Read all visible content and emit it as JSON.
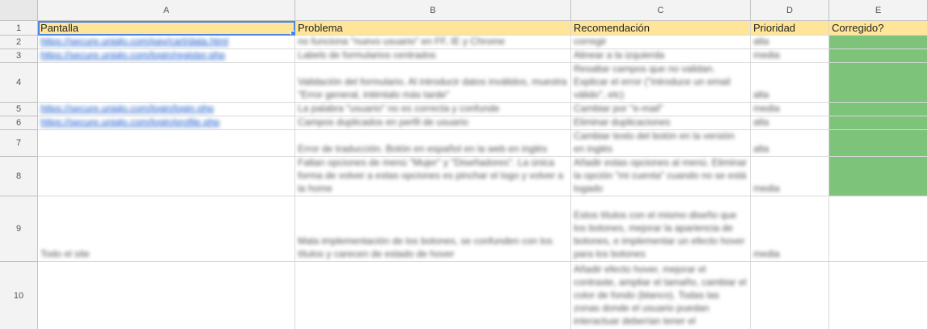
{
  "columns": [
    "A",
    "B",
    "C",
    "D",
    "E"
  ],
  "rows": [
    "1",
    "2",
    "3",
    "4",
    "5",
    "6",
    "7",
    "8",
    "9",
    "10"
  ],
  "header": {
    "a": "Pantalla",
    "b": "Problema",
    "c": "Recomendación",
    "d": "Prioridad",
    "e": "Corregido?"
  },
  "cells": {
    "r2": {
      "a": "https://secure.uniqlo.com/pay/cart/data.html",
      "b": "no funciona \"nuevo usuario\" en FF, IE y Chrome",
      "c": "corregir",
      "d": "alta"
    },
    "r3": {
      "a": "https://secure.uniqlo.com/login/register.php",
      "b": "Labels de formularios centrados",
      "c": "Alinear a la izquierda",
      "d": "media"
    },
    "r4": {
      "b": "Validación del formulario. Al introducir datos inválidos, muestra \"Error general, inténtalo más tarde\"",
      "c": "Resaltar campos que no validan. Explicar el error (\"introduce un email válido\", etc)",
      "d": "alta"
    },
    "r5": {
      "a": "https://secure.uniqlo.com/login/login.php",
      "b": "La palabra \"usuario\" no es correcta y confunde",
      "c": "Cambiar por \"e-mail\"",
      "d": "media"
    },
    "r6": {
      "a": "https://secure.uniqlo.com/login/profile.php",
      "b": "Campos duplicados en perfil de usuario",
      "c": "Eliminar duplicaciones",
      "d": "alta"
    },
    "r7": {
      "b": "Error de traducción. Botón en español en la web en inglés",
      "c": "Cambiar texto del botón en la versión en inglés",
      "d": "alta"
    },
    "r8": {
      "b": "Faltan opciones de menú \"Mujer\" y \"Diseñadores\". La única forma de volver a estas opciones es pinchar el logo y volver a la home",
      "c": "Añadir estas opciones al menú. Eliminar la opción \"mi cuenta\" cuando no se está logado",
      "d": "media"
    },
    "r9": {
      "a": "Todo el site",
      "b": "Mala implementación de los botones, se confunden con los títulos y carecen de estado de hover",
      "c": "Estos títulos con el mismo diseño que los botones, mejorar la apariencia de botones, e implementar un efecto hover para los botones",
      "d": "media"
    },
    "r10": {
      "c": "Añadir efecto hover, mejorar el contraste, ampliar el tamaño, cambiar el color de fondo (blanco). Todas las zonas donde el usuario puedan interactuar deberían tener el"
    }
  },
  "colors": {
    "header_fill": "#ffe599",
    "corrected_fill": "#7dc47a",
    "selection": "#4a86e8"
  }
}
